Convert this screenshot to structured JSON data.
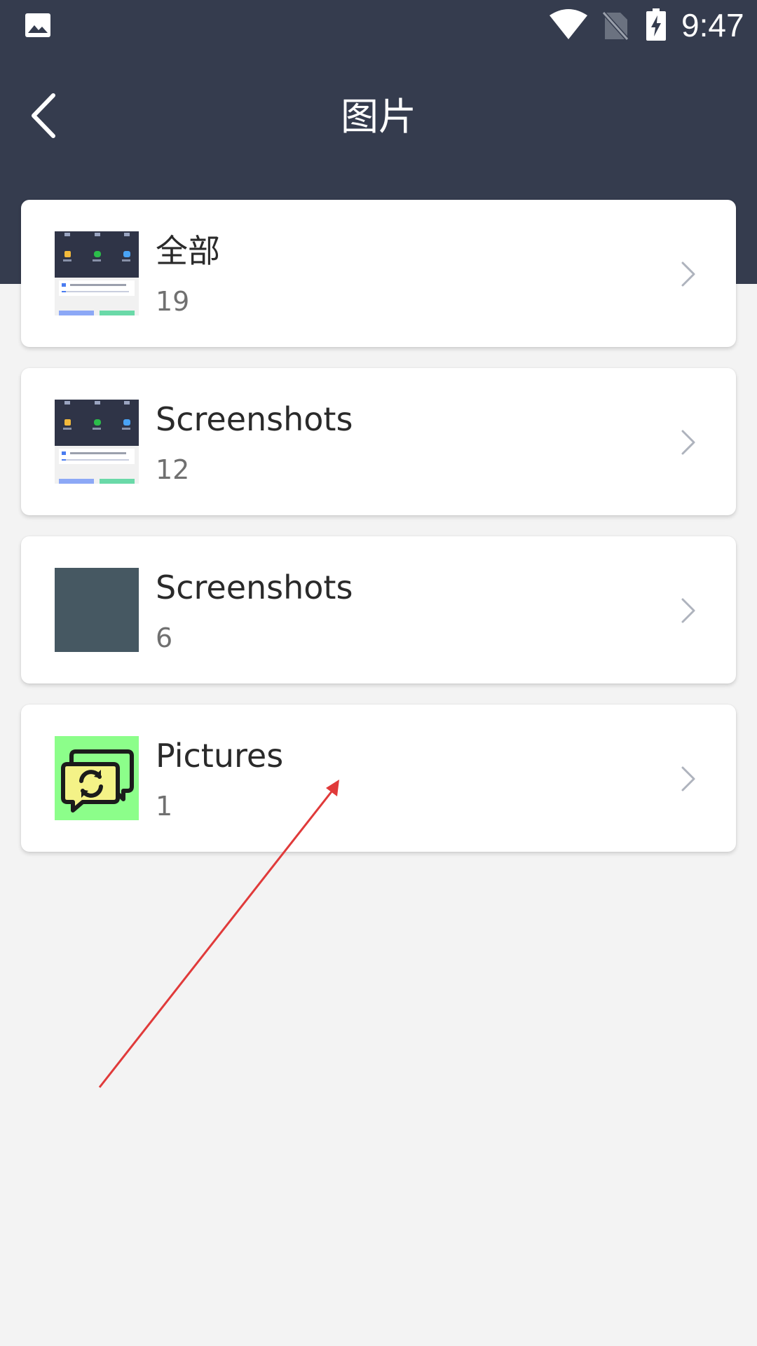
{
  "status_bar": {
    "time": "9:47",
    "icons": [
      "gallery-icon",
      "wifi-icon",
      "no-sim-icon",
      "battery-charging-icon"
    ]
  },
  "header": {
    "title": "图片",
    "back_icon": "chevron-left-icon"
  },
  "albums": [
    {
      "name": "全部",
      "count": "19",
      "thumb": "screenshot-thumbnail"
    },
    {
      "name": "Screenshots",
      "count": "12",
      "thumb": "screenshot-thumbnail"
    },
    {
      "name": "Screenshots",
      "count": "6",
      "thumb": "solid-slate-thumbnail"
    },
    {
      "name": "Pictures",
      "count": "1",
      "thumb": "sync-chat-icon-thumbnail"
    }
  ],
  "colors": {
    "header_bg": "#353c4e",
    "page_bg": "#f3f3f3",
    "card_bg": "#ffffff",
    "annotation_arrow": "#e03a3a"
  }
}
